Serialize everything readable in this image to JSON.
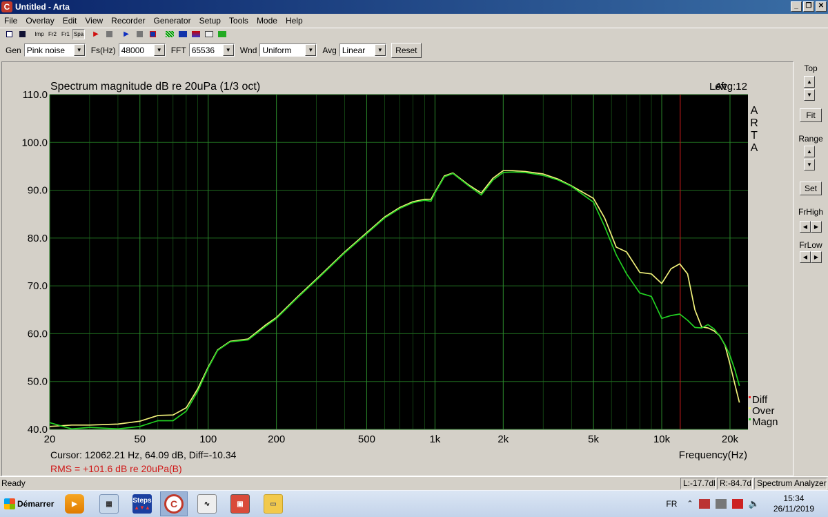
{
  "window": {
    "title": "Untitled - Arta",
    "app_icon": "C"
  },
  "menu": [
    "File",
    "Overlay",
    "Edit",
    "View",
    "Recorder",
    "Generator",
    "Setup",
    "Tools",
    "Mode",
    "Help"
  ],
  "iconbar": {
    "imp": "Imp",
    "fr2": "Fr2",
    "fr1": "Fr1",
    "spa": "Spa"
  },
  "params": {
    "gen_label": "Gen",
    "gen_value": "Pink noise",
    "fs_label": "Fs(Hz)",
    "fs_value": "48000",
    "fft_label": "FFT",
    "fft_value": "65536",
    "wnd_label": "Wnd",
    "wnd_value": "Uniform",
    "avg_label": "Avg",
    "avg_value": "Linear",
    "reset_label": "Reset"
  },
  "plot": {
    "title": "Spectrum magnitude dB re 20uPa (1/3 oct)",
    "channel": "Left",
    "avg": "Avg:12",
    "watermark": "ARTA",
    "xlabel": "Frequency(Hz)",
    "cursor": "Cursor: 12062.21 Hz, 64.09 dB,  Diff=-10.34",
    "rms": "RMS = +101.6 dB re 20uPa(B)",
    "legend": [
      "Diff",
      "Over",
      "Magn"
    ]
  },
  "colors": {
    "plot_bg": "#000000",
    "grid": "#1f6b1f",
    "over": "#f0f07a",
    "magn": "#22d022",
    "diff": "#ff2020",
    "cursor": "#b01818",
    "rms": "#d01818"
  },
  "chart_data": {
    "type": "line",
    "xscale": "log",
    "xlim": [
      20,
      24000
    ],
    "ylim": [
      40,
      110
    ],
    "yticks": [
      "110.0",
      "100.0",
      "90.0",
      "80.0",
      "70.0",
      "60.0",
      "50.0",
      "40.0"
    ],
    "yticks_values": [
      110,
      100,
      90,
      80,
      70,
      60,
      50,
      40
    ],
    "xticks": [
      {
        "label": "20",
        "value": 20
      },
      {
        "label": "50",
        "value": 50
      },
      {
        "label": "100",
        "value": 100
      },
      {
        "label": "200",
        "value": 200
      },
      {
        "label": "500",
        "value": 500
      },
      {
        "label": "1k",
        "value": 1000
      },
      {
        "label": "2k",
        "value": 2000
      },
      {
        "label": "5k",
        "value": 5000
      },
      {
        "label": "10k",
        "value": 10000
      },
      {
        "label": "20k",
        "value": 20000
      }
    ],
    "cursor_x": 12062.21,
    "series": [
      {
        "name": "Over",
        "x": [
          20,
          25,
          30,
          40,
          50,
          60,
          70,
          80,
          90,
          100,
          110,
          125,
          150,
          180,
          200,
          250,
          300,
          400,
          500,
          600,
          700,
          800,
          900,
          960,
          1000,
          1100,
          1200,
          1400,
          1600,
          1800,
          2000,
          2200,
          2500,
          3000,
          3500,
          4000,
          5000,
          5600,
          6300,
          7000,
          8000,
          9000,
          10000,
          11000,
          12000,
          13000,
          14000,
          15000,
          16000,
          17000,
          18000,
          19000,
          20000,
          21000,
          22000
        ],
        "y": [
          40.6,
          40.9,
          40.9,
          41.1,
          41.7,
          42.9,
          43.0,
          44.5,
          48.5,
          53.0,
          56.6,
          58.4,
          58.9,
          61.9,
          63.4,
          67.9,
          71.4,
          77.1,
          81.1,
          84.4,
          86.4,
          87.6,
          88.1,
          88.1,
          89.6,
          93.0,
          93.6,
          91.2,
          89.4,
          92.5,
          94.1,
          94.1,
          93.9,
          93.4,
          92.3,
          90.9,
          88.3,
          84.2,
          78.1,
          77.1,
          72.8,
          72.5,
          70.5,
          73.6,
          74.6,
          72.5,
          65.0,
          61.4,
          61.2,
          60.6,
          59.6,
          57.6,
          53.6,
          49.5,
          45.6
        ]
      },
      {
        "name": "Magn",
        "x": [
          20,
          25,
          30,
          40,
          50,
          60,
          70,
          80,
          90,
          100,
          110,
          125,
          150,
          180,
          200,
          250,
          300,
          400,
          500,
          600,
          700,
          800,
          900,
          960,
          1000,
          1100,
          1200,
          1400,
          1600,
          1800,
          2000,
          2200,
          2500,
          3000,
          3500,
          4000,
          5000,
          5600,
          6300,
          7000,
          8000,
          9000,
          10000,
          11000,
          12000,
          13000,
          14000,
          15000,
          16000,
          17000,
          18000,
          19000,
          20000,
          21000,
          22000
        ],
        "y": [
          41.4,
          40.1,
          40.4,
          40.1,
          40.6,
          41.8,
          41.8,
          43.8,
          48.0,
          52.8,
          56.5,
          58.3,
          58.7,
          61.6,
          63.2,
          67.7,
          71.2,
          76.9,
          80.9,
          84.2,
          86.2,
          87.4,
          87.9,
          87.7,
          89.4,
          92.8,
          93.5,
          91.0,
          89.0,
          92.1,
          93.7,
          93.8,
          93.7,
          93.1,
          92.1,
          90.8,
          87.5,
          82.4,
          76.5,
          72.5,
          68.5,
          67.8,
          63.2,
          63.8,
          64.1,
          62.8,
          61.3,
          61.2,
          61.9,
          61.0,
          59.5,
          57.7,
          55.4,
          52.5,
          49.1
        ]
      }
    ]
  },
  "side": {
    "top": "Top",
    "fit": "Fit",
    "range": "Range",
    "set": "Set",
    "frhigh": "FrHigh",
    "frlow": "FrLow"
  },
  "status": {
    "text": "Ready",
    "l_level": "L:-17.7dl",
    "r_level": "R:-84.7d",
    "mode": "Spectrum Analyzer"
  },
  "taskbar": {
    "start": "Démarrer",
    "apps": [
      "media-player",
      "calculator",
      "steps",
      "arta",
      "limp",
      "screenshot-tool",
      "explorer"
    ],
    "steps_label": "Steps",
    "lang": "FR",
    "time": "15:34",
    "date": "26/11/2019"
  }
}
